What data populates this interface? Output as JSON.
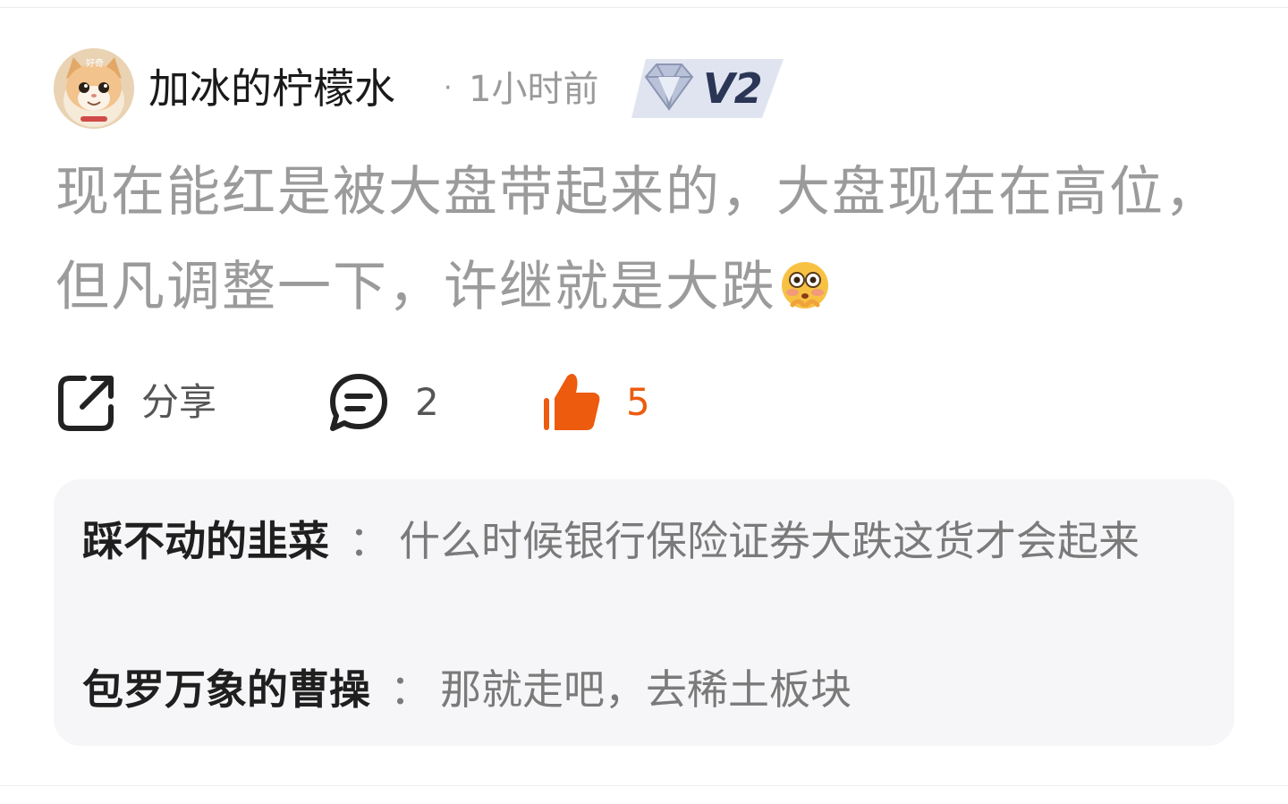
{
  "post": {
    "author": "加冰的柠檬水",
    "separator": "·",
    "time": "1小时前",
    "level": "V2",
    "content": "现在能红是被大盘带起来的，大盘现在在高位，但凡调整一下，许继就是大跌",
    "content_emoji": "flushed-face-emoji",
    "avatar_caption": "好奇"
  },
  "actions": {
    "share_label": "分享",
    "comment_count": "2",
    "like_count": "5",
    "like_color": "#ec5b0e"
  },
  "replies": [
    {
      "author": "踩不动的韭菜",
      "separator": "：",
      "text": "什么时候银行保险证券大跌这货才会起来"
    },
    {
      "author": "包罗万象的曹操",
      "separator": "：",
      "text": "那就走吧，去稀土板块"
    }
  ],
  "colors": {
    "muted_text": "#9b9b9b",
    "reply_background": "#f6f6f8",
    "accent": "#ec5b0e"
  }
}
